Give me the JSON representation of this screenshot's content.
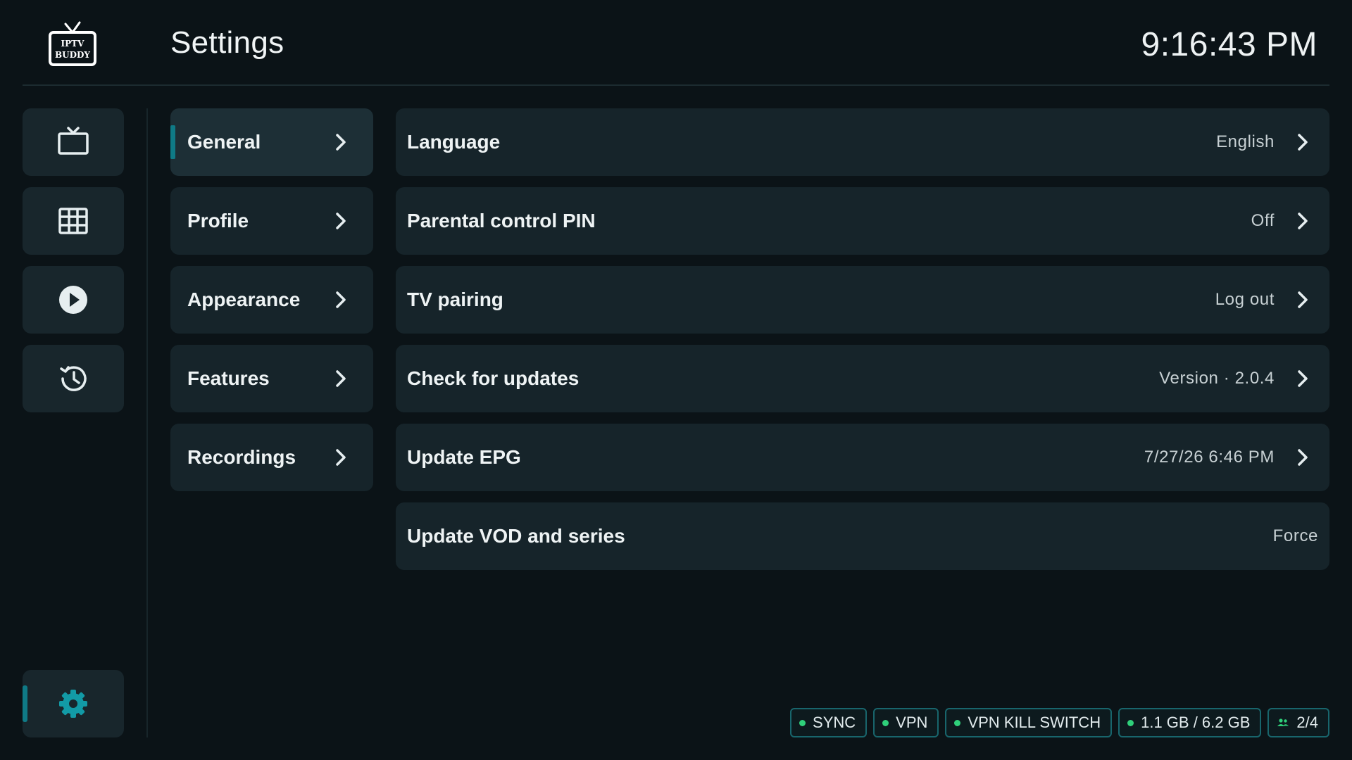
{
  "header": {
    "logo_text_line1": "IPTV",
    "logo_text_line2": "BUDDY",
    "title": "Settings",
    "clock": "9:16:43 PM"
  },
  "rail": {
    "items": [
      {
        "name": "live-tv",
        "icon": "tv-icon",
        "active": false
      },
      {
        "name": "epg-guide",
        "icon": "grid-icon",
        "active": false
      },
      {
        "name": "vod",
        "icon": "play-icon",
        "active": false
      },
      {
        "name": "history",
        "icon": "history-icon",
        "active": false
      },
      {
        "name": "settings",
        "icon": "gear-icon",
        "active": true
      }
    ]
  },
  "categories": [
    {
      "label": "General",
      "active": true
    },
    {
      "label": "Profile",
      "active": false
    },
    {
      "label": "Appearance",
      "active": false
    },
    {
      "label": "Features",
      "active": false
    },
    {
      "label": "Recordings",
      "active": false
    }
  ],
  "settings": [
    {
      "label": "Language",
      "value": "English",
      "chevron": true
    },
    {
      "label": "Parental control PIN",
      "value": "Off",
      "chevron": true
    },
    {
      "label": "TV pairing",
      "value": "Log out",
      "chevron": true
    },
    {
      "label": "Check for updates",
      "value": "Version · 2.0.4",
      "chevron": true
    },
    {
      "label": "Update EPG",
      "value": "7/27/26 6:46 PM",
      "chevron": true
    },
    {
      "label": "Update VOD and series",
      "value": "Force",
      "chevron": false
    }
  ],
  "status": {
    "sync": "SYNC",
    "vpn": "VPN",
    "vpn_kill_switch": "VPN KILL SWITCH",
    "storage": "1.1 GB / 6.2 GB",
    "users": "2/4"
  },
  "colors": {
    "background": "#0b1317",
    "card": "#16242a",
    "accent": "#0f7a86",
    "status_dot": "#2fd07a"
  }
}
